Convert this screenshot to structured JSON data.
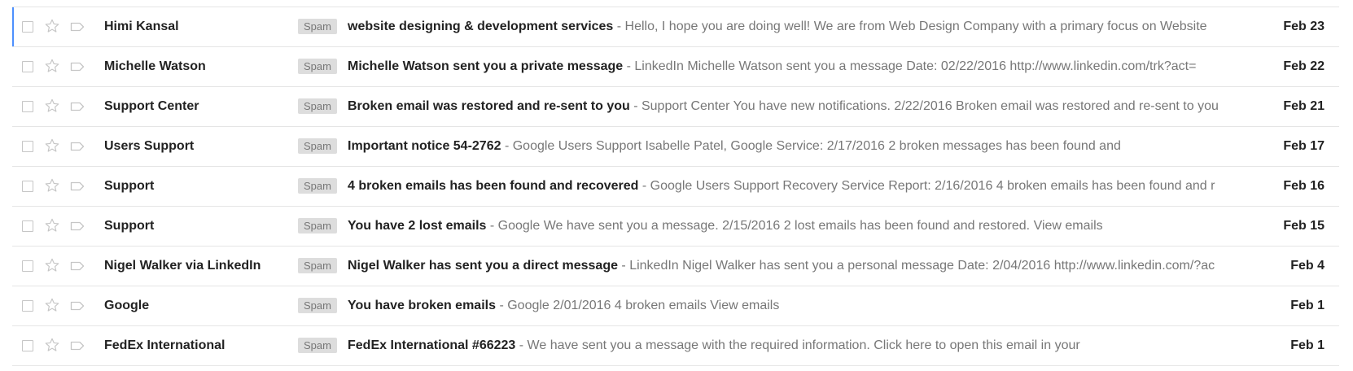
{
  "colors": {
    "focus_bar": "#4d90fe",
    "spam_tag_bg": "#dddddd",
    "spam_tag_text": "#777777",
    "text_bold": "#222222",
    "text_snippet": "#777777"
  },
  "icons": {
    "checkbox": "checkbox-icon",
    "star": "star-outline-icon",
    "label": "label-tag-icon"
  },
  "emails": [
    {
      "sender": "Himi Kansal",
      "tag": "Spam",
      "subject": "website designing & development services",
      "snippet": " - Hello, I hope you are doing well! We are from Web Design Company with a primary focus on Website",
      "date": "Feb 23"
    },
    {
      "sender": "Michelle Watson",
      "tag": "Spam",
      "subject": "Michelle Watson sent you a private message",
      "snippet": " - LinkedIn Michelle Watson sent you a message Date: 02/22/2016 http://www.linkedin.com/trk?act=",
      "date": "Feb 22"
    },
    {
      "sender": "Support Center",
      "tag": "Spam",
      "subject": "Broken email was restored and re-sent to you",
      "snippet": " - Support Center You have new notifications. 2/22/2016 Broken email was restored and re-sent to you",
      "date": "Feb 21"
    },
    {
      "sender": "Users Support",
      "tag": "Spam",
      "subject": "Important notice 54-2762",
      "snippet": " - Google Users Support Isabelle Patel, Google Service: 2/17/2016 2 broken messages has been found and",
      "date": "Feb 17"
    },
    {
      "sender": "Support",
      "tag": "Spam",
      "subject": "4 broken emails has been found and recovered",
      "snippet": " - Google Users Support Recovery Service Report: 2/16/2016 4 broken emails has been found and r",
      "date": "Feb 16"
    },
    {
      "sender": "Support",
      "tag": "Spam",
      "subject": "You have 2 lost emails",
      "snippet": " - Google We have sent you a message. 2/15/2016 2 lost emails has been found and restored. View emails",
      "date": "Feb 15"
    },
    {
      "sender": "Nigel Walker via LinkedIn",
      "tag": "Spam",
      "subject": "Nigel Walker has sent you a direct message",
      "snippet": " - LinkedIn Nigel Walker has sent you a personal message Date: 2/04/2016 http://www.linkedin.com/?ac",
      "date": "Feb 4"
    },
    {
      "sender": "Google",
      "tag": "Spam",
      "subject": "You have broken emails",
      "snippet": " - Google 2/01/2016 4 broken emails View emails",
      "date": "Feb 1"
    },
    {
      "sender": "FedEx International",
      "tag": "Spam",
      "subject": "FedEx International #66223",
      "snippet": " - We have sent you a message with the required information. Click here to open this email in your",
      "date": "Feb 1"
    }
  ]
}
